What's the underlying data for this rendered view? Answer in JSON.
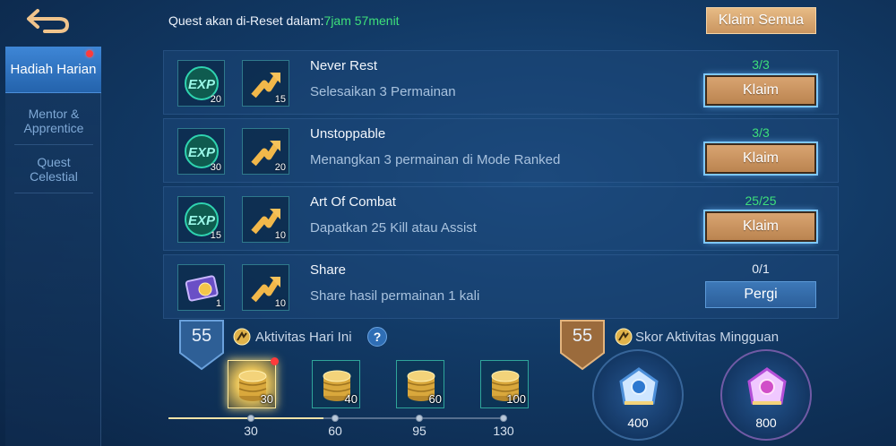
{
  "header": {
    "reset_label": "Quest akan di-Reset dalam:",
    "reset_time": "7jam 57menit",
    "claim_all_label": "Klaim Semua"
  },
  "sidebar": {
    "items": [
      {
        "label": "Hadiah Harian",
        "active": true
      },
      {
        "label": "Mentor & Apprentice",
        "active": false
      },
      {
        "label": "Quest Celestial",
        "active": false
      }
    ]
  },
  "quests": [
    {
      "title": "Never Rest",
      "desc": "Selesaikan 3 Permainan",
      "progress": "3/3",
      "button": "Klaim",
      "rewards": [
        {
          "icon": "exp-icon",
          "qty": "20"
        },
        {
          "icon": "activity-point-icon",
          "qty": "15"
        }
      ]
    },
    {
      "title": "Unstoppable",
      "desc": "Menangkan 3 permainan di Mode Ranked",
      "progress": "3/3",
      "button": "Klaim",
      "rewards": [
        {
          "icon": "exp-icon",
          "qty": "30"
        },
        {
          "icon": "activity-point-icon",
          "qty": "20"
        }
      ]
    },
    {
      "title": "Art Of Combat",
      "desc": "Dapatkan 25 Kill atau Assist",
      "progress": "25/25",
      "button": "Klaim",
      "rewards": [
        {
          "icon": "exp-icon",
          "qty": "15"
        },
        {
          "icon": "activity-point-icon",
          "qty": "10"
        }
      ]
    },
    {
      "title": "Share",
      "desc": "Share hasil permainan 1 kali",
      "progress": "0/1",
      "button": "Pergi",
      "rewards": [
        {
          "icon": "coin-ticket-icon",
          "qty": "1"
        },
        {
          "icon": "activity-point-icon",
          "qty": "10"
        }
      ]
    }
  ],
  "daily": {
    "score": "55",
    "label": "Aktivitas Hari Ini",
    "help": "?",
    "chests": [
      {
        "qty": "30"
      },
      {
        "qty": "40"
      },
      {
        "qty": "60"
      },
      {
        "qty": "100"
      }
    ],
    "milestones": [
      "30",
      "60",
      "95",
      "130"
    ],
    "progress_fraction": 0.46
  },
  "weekly": {
    "score": "55",
    "label": "Skor Aktivitas Mingguan",
    "rewards": [
      {
        "value": "400"
      },
      {
        "value": "800"
      }
    ]
  },
  "colors": {
    "accent_green": "#3ee07a",
    "claim_gold": "#d8a471",
    "go_blue": "#2c5f9a"
  }
}
